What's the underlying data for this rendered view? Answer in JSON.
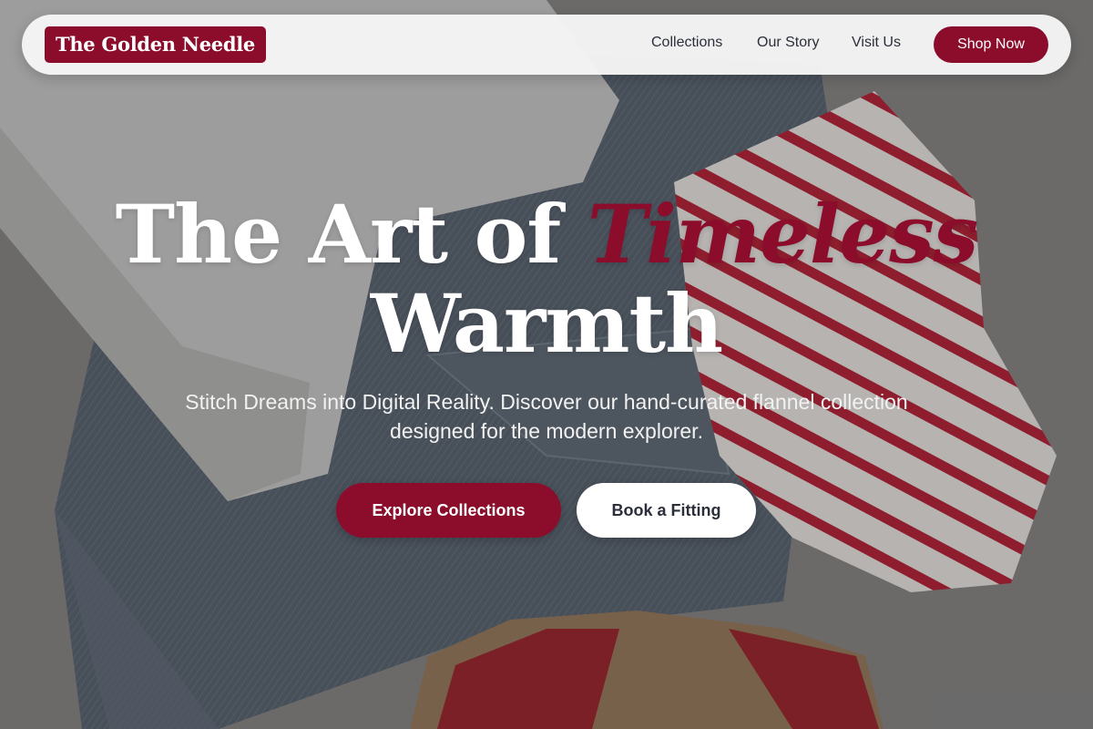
{
  "brand": {
    "name": "The Golden Needle"
  },
  "nav": {
    "links": [
      "Collections",
      "Our Story",
      "Visit Us"
    ],
    "cta_label": "Shop Now"
  },
  "hero": {
    "headline_part1": "The Art of ",
    "headline_accent": "Timeless",
    "headline_line2": "Warmth",
    "subtitle": "Stitch Dreams into Digital Reality. Discover our hand-curated flannel collection designed for the modern explorer.",
    "primary_button": "Explore Collections",
    "secondary_button": "Book a Fitting",
    "background_image": "flat-lay-clothing-photo"
  },
  "colors": {
    "accent": "#8b0d2b",
    "navbar_bg": "#f6f6f6",
    "text_dark": "#2b2f3a",
    "text_light": "#ffffff"
  }
}
